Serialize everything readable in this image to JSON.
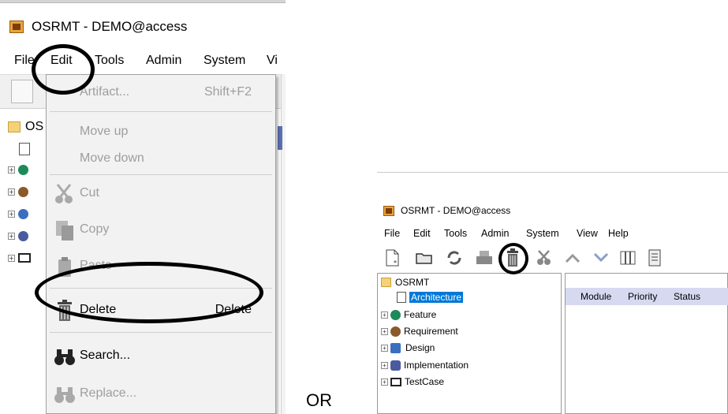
{
  "left": {
    "window_title": "OSRMT - DEMO@access",
    "menus": [
      "File",
      "Edit",
      "Tools",
      "Admin",
      "System",
      "Vi"
    ],
    "tree_root": "OS",
    "dropdown_items": [
      {
        "label": "Artifact...",
        "shortcut": "Shift+F2",
        "enabled": false,
        "icon": "artifact-icon"
      },
      {
        "label": "Move up",
        "shortcut": "",
        "enabled": false,
        "icon": ""
      },
      {
        "label": "Move down",
        "shortcut": "",
        "enabled": false,
        "icon": ""
      },
      {
        "label": "Cut",
        "shortcut": "",
        "enabled": false,
        "icon": "scissors-icon"
      },
      {
        "label": "Copy",
        "shortcut": "",
        "enabled": false,
        "icon": "copy-icon"
      },
      {
        "label": "Paste",
        "shortcut": "",
        "enabled": false,
        "icon": "paste-icon"
      },
      {
        "label": "Delete",
        "shortcut": "Delete",
        "enabled": true,
        "icon": "trash-icon"
      },
      {
        "label": "Search...",
        "shortcut": "",
        "enabled": true,
        "icon": "binoculars-icon"
      },
      {
        "label": "Replace...",
        "shortcut": "",
        "enabled": false,
        "icon": "binoculars-icon"
      }
    ]
  },
  "separator_text": "OR",
  "right": {
    "window_title": "OSRMT - DEMO@access",
    "menus": [
      "File",
      "Edit",
      "Tools",
      "Admin",
      "System",
      "View",
      "Help"
    ],
    "tree": {
      "root": "OSRMT",
      "items": [
        "Architecture",
        "Feature",
        "Requirement",
        "Design",
        "Implementation",
        "TestCase"
      ]
    },
    "table_headers": [
      "Module",
      "Priority",
      "Status"
    ]
  },
  "colors": {
    "highlight": "#0078d7",
    "annotation": "#000000",
    "table_header_bg": "#d6d9f0"
  }
}
